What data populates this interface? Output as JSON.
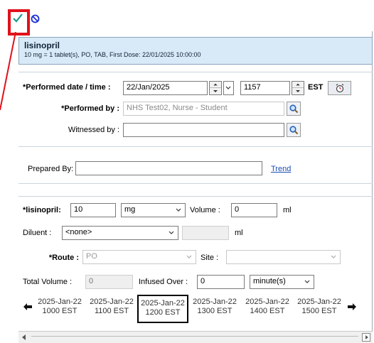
{
  "toolbar": {
    "confirm_icon": "checkmark-icon",
    "cancel_icon": "no-entry-icon"
  },
  "medication": {
    "name": "lisinopril",
    "detail": "10 mg = 1 tablet(s), PO, TAB, First Dose: 22/01/2025 10:00:00"
  },
  "performed": {
    "datetime_label": "*Performed date / time :",
    "date": "22/Jan/2025",
    "time": "1157",
    "timezone": "EST",
    "by_label": "*Performed by :",
    "by_value": "NHS Test02, Nurse - Student",
    "witnessed_label": "Witnessed by :",
    "witnessed_value": ""
  },
  "prepared": {
    "label": "Prepared By:",
    "value": "",
    "trend_link": "Trend"
  },
  "dose": {
    "label": "*lisinopril:",
    "amount": "10",
    "unit": "mg",
    "volume_label": "Volume :",
    "volume": "0",
    "volume_unit": "ml",
    "diluent_label": "Diluent :",
    "diluent": "<none>",
    "diluent_volume": "",
    "diluent_unit": "ml",
    "route_label": "*Route :",
    "route": "PO",
    "site_label": "Site :",
    "site": "",
    "total_volume_label": "Total Volume :",
    "total_volume": "0",
    "infused_over_label": "Infused Over :",
    "infused_over": "0",
    "infused_unit": "minute(s)"
  },
  "timeline": {
    "slots": [
      {
        "date": "2025-Jan-22",
        "time": "1000 EST"
      },
      {
        "date": "2025-Jan-22",
        "time": "1100 EST"
      },
      {
        "date": "2025-Jan-22",
        "time": "1200 EST"
      },
      {
        "date": "2025-Jan-22",
        "time": "1300 EST"
      },
      {
        "date": "2025-Jan-22",
        "time": "1400 EST"
      },
      {
        "date": "2025-Jan-22",
        "time": "1500 EST"
      }
    ],
    "selected_index": 2
  },
  "colors": {
    "highlight": "#e0121b",
    "header_bg": "#d8eaf7",
    "link": "#1a4fb5"
  }
}
